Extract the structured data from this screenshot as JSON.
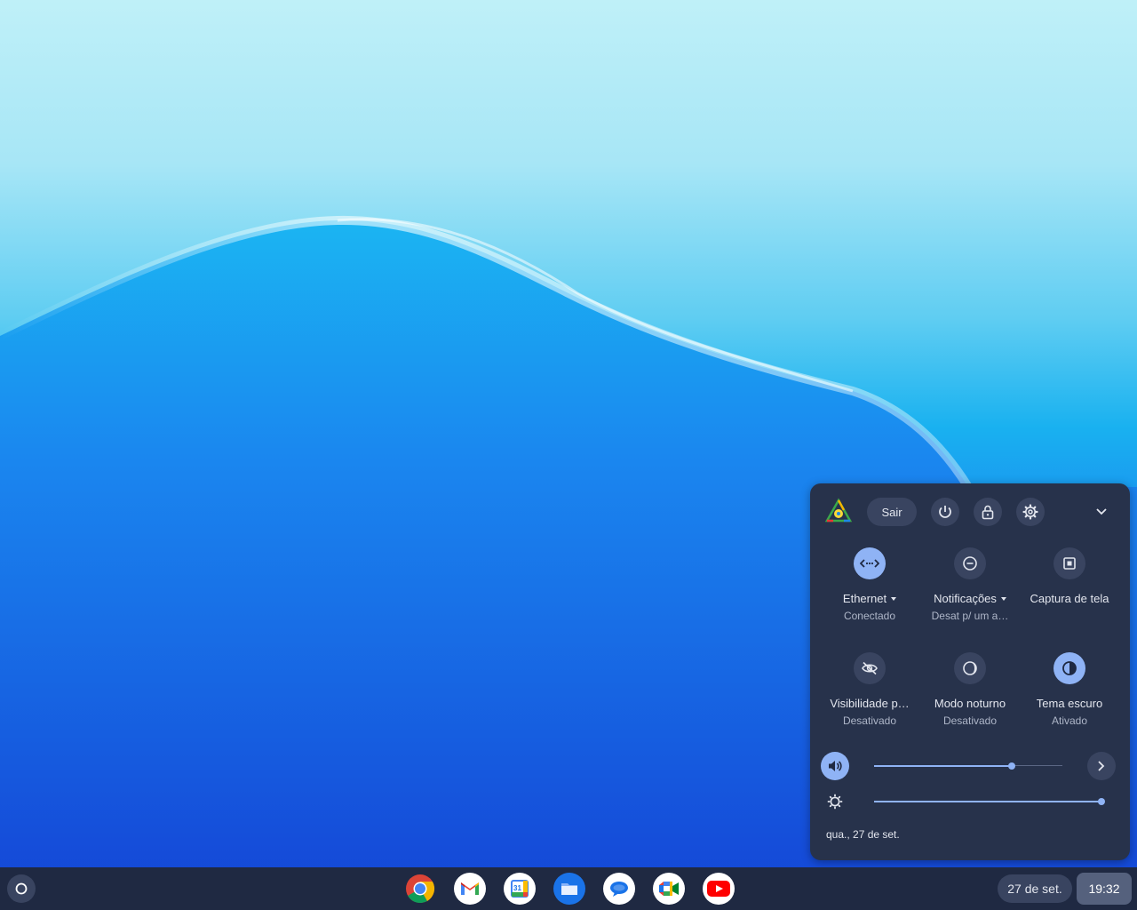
{
  "quick_settings": {
    "sign_out_label": "Sair",
    "tiles": [
      {
        "label": "Ethernet",
        "sublabel": "Conectado",
        "icon": "ethernet-icon",
        "active": true,
        "has_menu": true
      },
      {
        "label": "Notificações",
        "sublabel": "Desat p/ um a…",
        "icon": "do-not-disturb-icon",
        "active": false,
        "has_menu": true
      },
      {
        "label": "Captura de tela",
        "sublabel": "",
        "icon": "screen-capture-icon",
        "active": false,
        "has_menu": false
      },
      {
        "label": "Visibilidade p…",
        "sublabel": "Desativado",
        "icon": "visibility-off-icon",
        "active": false,
        "has_menu": false
      },
      {
        "label": "Modo noturno",
        "sublabel": "Desativado",
        "icon": "night-light-icon",
        "active": false,
        "has_menu": false
      },
      {
        "label": "Tema escuro",
        "sublabel": "Ativado",
        "icon": "dark-theme-icon",
        "active": true,
        "has_menu": false
      }
    ],
    "volume_level": 0.73,
    "brightness_level": 1.0,
    "date_text": "qua., 27 de set.",
    "accent_color": "#8fb3f5"
  },
  "shelf": {
    "apps": [
      "Chrome",
      "Gmail",
      "Google Calendar",
      "Files",
      "Messages",
      "Google Meet",
      "YouTube"
    ],
    "calendar_day": "31",
    "date_label": "27 de set.",
    "time_label": "19:32"
  }
}
